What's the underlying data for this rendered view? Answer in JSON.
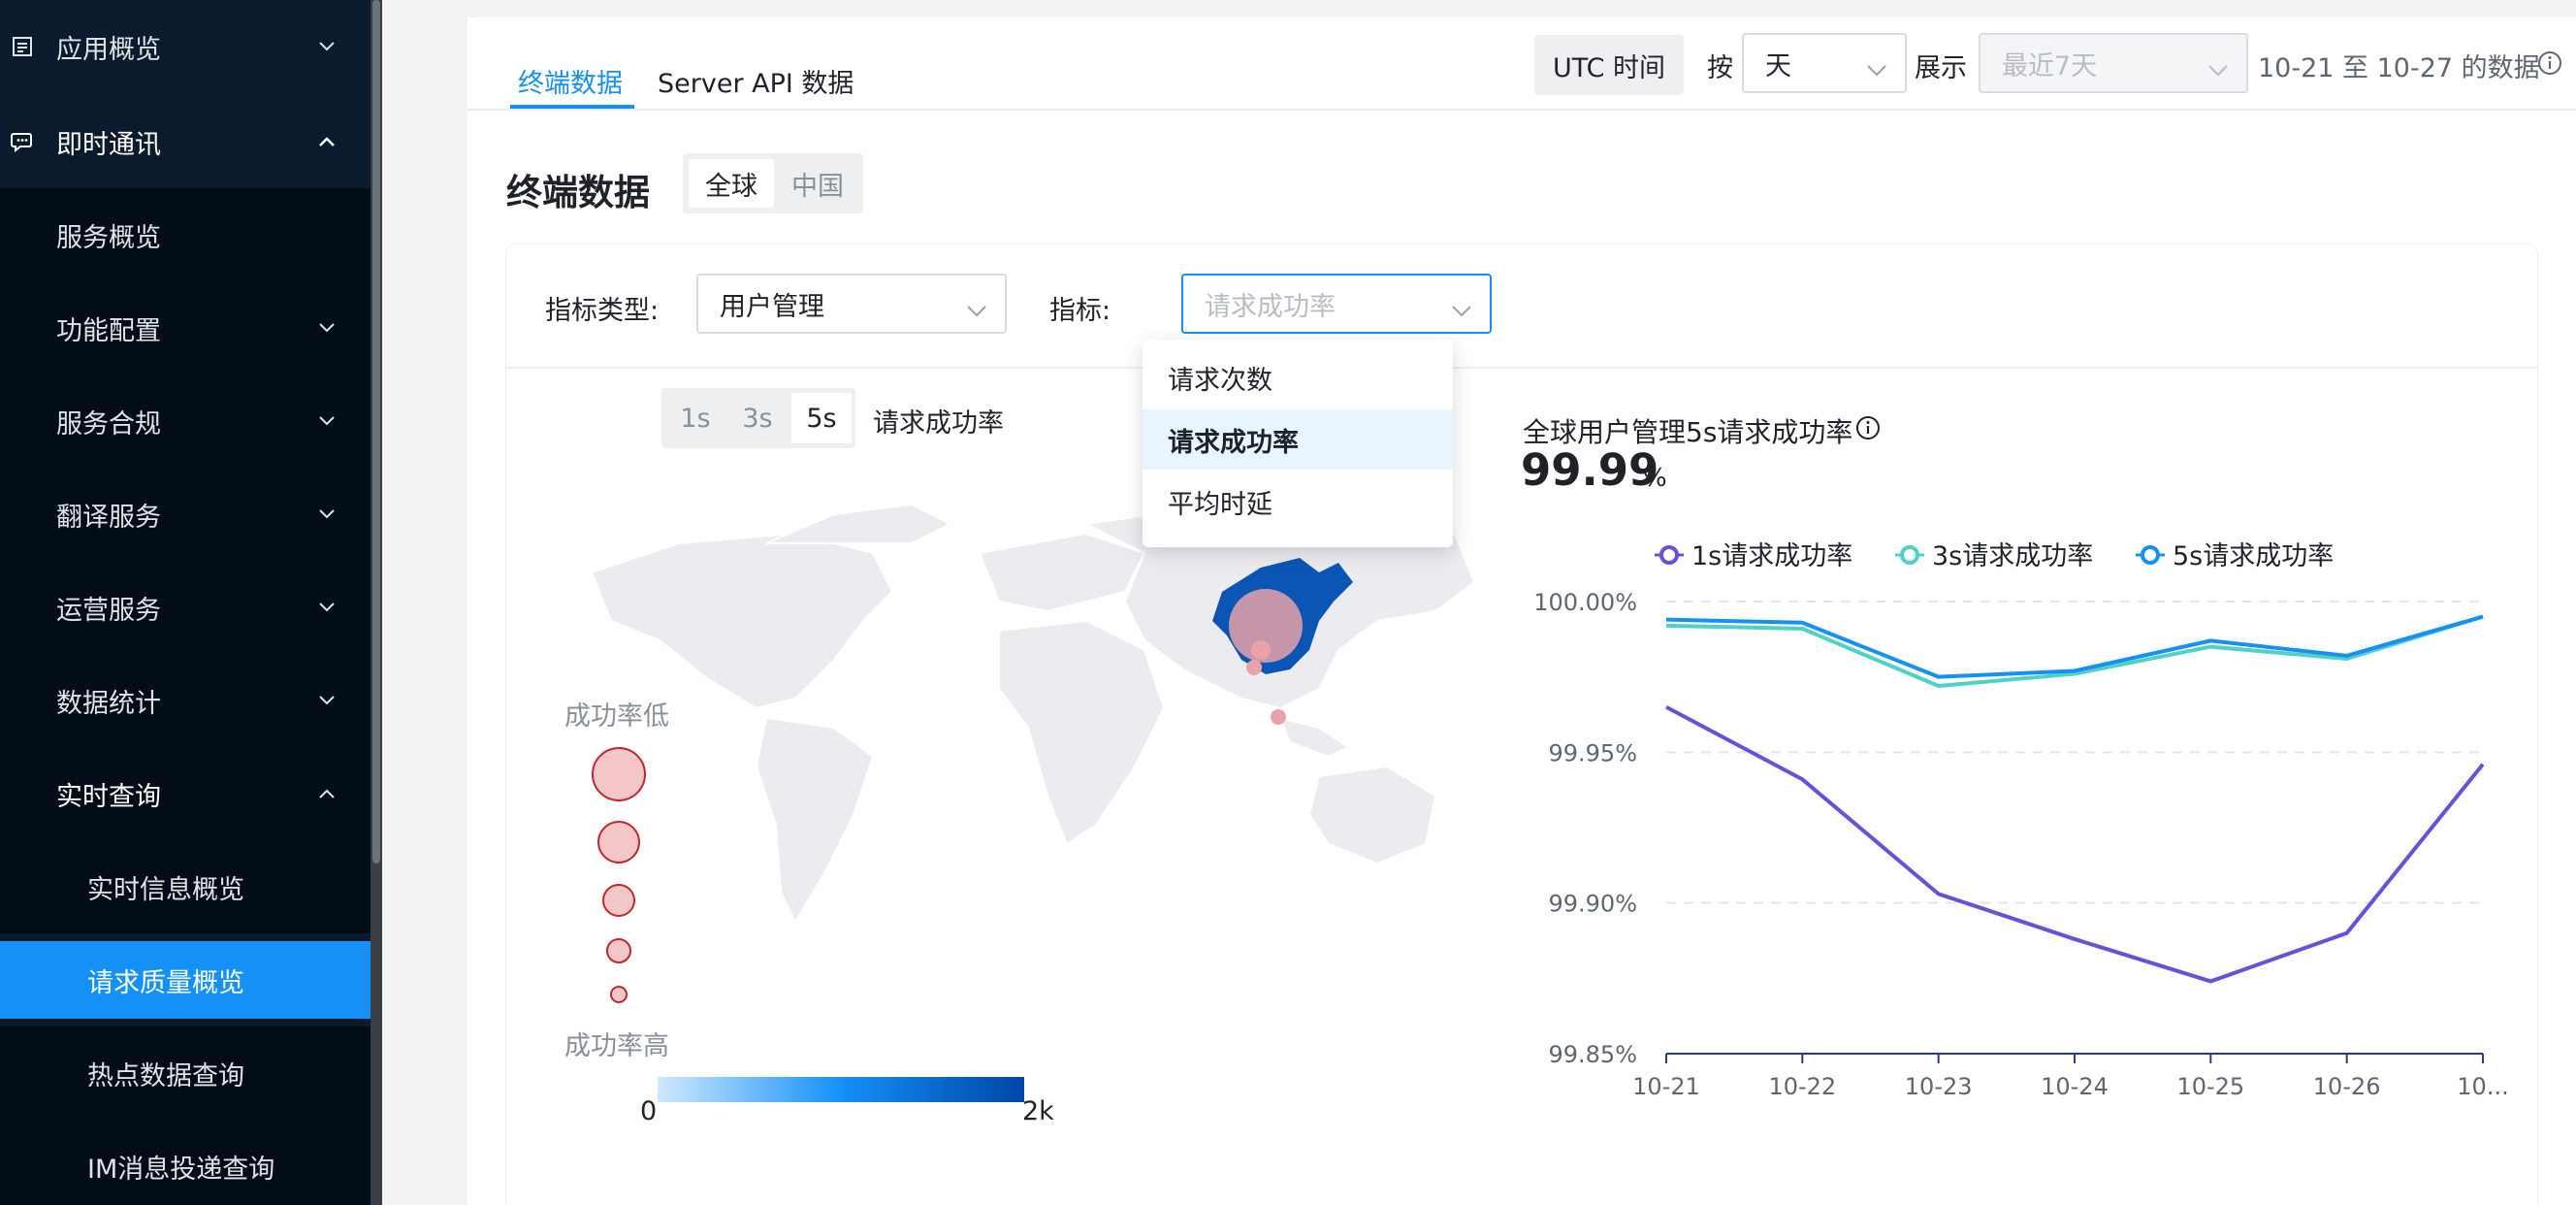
{
  "sidebar": {
    "items": [
      {
        "label": "应用概览",
        "icon": "list-icon",
        "chevron": "down"
      },
      {
        "label": "即时通讯",
        "icon": "chat-icon",
        "chevron": "up"
      },
      {
        "label": "服务概览"
      },
      {
        "label": "功能配置",
        "chevron": "down"
      },
      {
        "label": "服务合规",
        "chevron": "down"
      },
      {
        "label": "翻译服务",
        "chevron": "down"
      },
      {
        "label": "运营服务",
        "chevron": "down"
      },
      {
        "label": "数据统计",
        "chevron": "down"
      },
      {
        "label": "实时查询",
        "chevron": "up"
      },
      {
        "label": "实时信息概览"
      },
      {
        "label": "请求质量概览",
        "active": true
      },
      {
        "label": "热点数据查询"
      },
      {
        "label": "IM消息投递查询"
      }
    ]
  },
  "tabs": [
    {
      "label": "终端数据",
      "active": true
    },
    {
      "label": "Server API 数据"
    }
  ],
  "header": {
    "utc_label": "UTC 时间",
    "by_label": "按",
    "by_value": "天",
    "show_label": "展示",
    "range_value": "最近7天",
    "range_text": "10-21 至 10-27 的数据"
  },
  "section": {
    "title": "终端数据",
    "regions": [
      "全球",
      "中国"
    ],
    "active_region": "全球"
  },
  "filters": {
    "type_label": "指标类型:",
    "type_value": "用户管理",
    "metric_label": "指标:",
    "metric_placeholder": "请求成功率",
    "options": [
      "请求次数",
      "请求成功率",
      "平均时延"
    ],
    "selected_option": "请求成功率"
  },
  "map_panel": {
    "time_options": [
      "1s",
      "3s",
      "5s"
    ],
    "active_time": "5s",
    "metric_title": "请求成功率",
    "legend_low": "成功率低",
    "legend_high": "成功率高",
    "scale_min": "0",
    "scale_max": "2k"
  },
  "chart_panel": {
    "title": "全球用户管理5s请求成功率",
    "value": "99.99",
    "unit": "%"
  },
  "chart_data": {
    "type": "line",
    "x": [
      "10-21",
      "10-22",
      "10-23",
      "10-24",
      "10-25",
      "10-26",
      "10..."
    ],
    "series": [
      {
        "name": "1s请求成功率",
        "color": "#6c4fd8",
        "values": [
          99.965,
          99.941,
          99.903,
          99.888,
          99.874,
          99.89,
          99.946
        ]
      },
      {
        "name": "3s请求成功率",
        "color": "#4fd1c5",
        "values": [
          99.992,
          99.991,
          99.972,
          99.976,
          99.985,
          99.981,
          99.995
        ]
      },
      {
        "name": "5s请求成功率",
        "color": "#1590f7",
        "values": [
          99.994,
          99.993,
          99.975,
          99.977,
          99.987,
          99.982,
          99.995
        ]
      }
    ],
    "y_ticks": [
      "100.00%",
      "99.95%",
      "99.90%",
      "99.85%"
    ],
    "ylim": [
      99.85,
      100.0
    ],
    "grid": true,
    "legend": "top"
  }
}
